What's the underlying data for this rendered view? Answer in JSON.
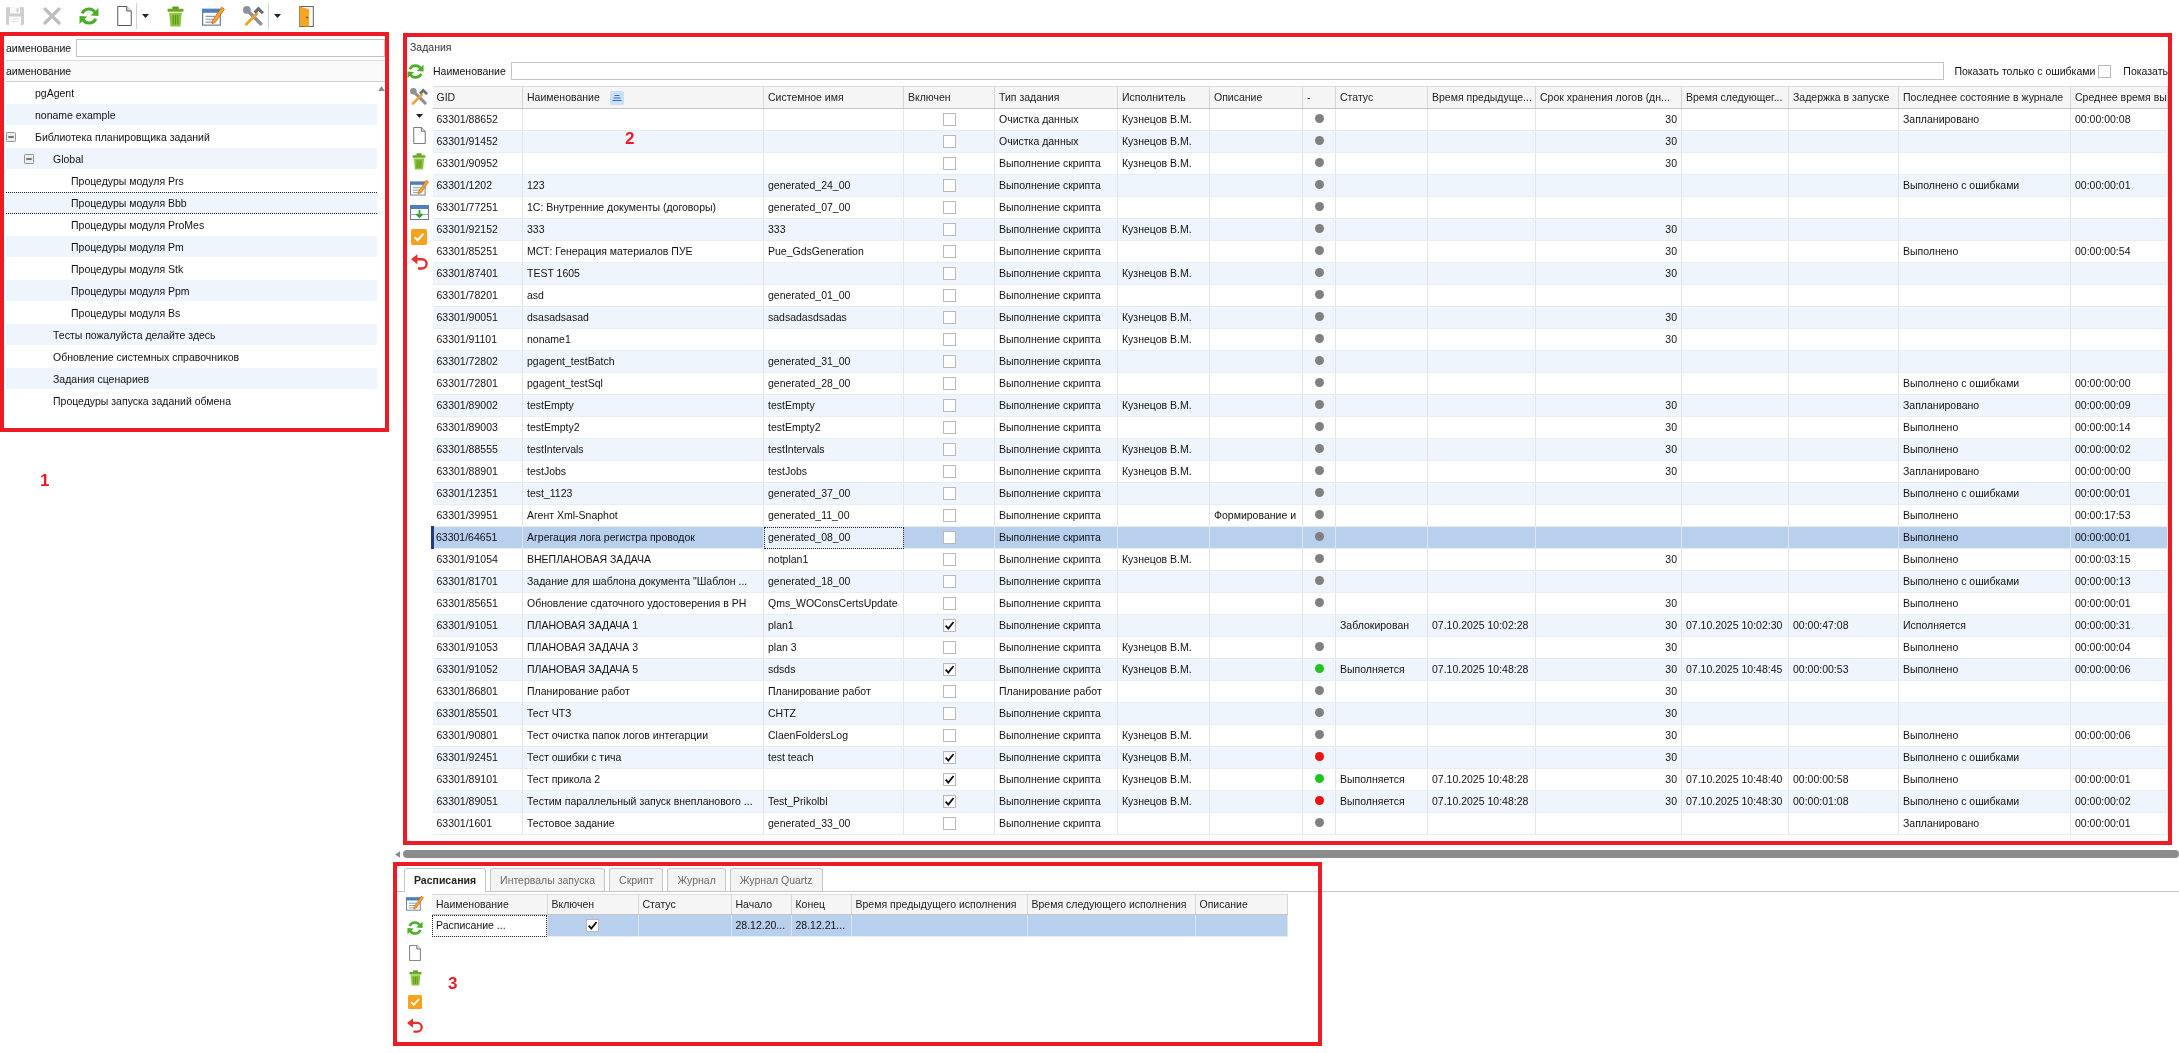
{
  "toolbar": [
    {
      "disabled": true
    },
    {
      "disabled": true
    },
    {
      "disabled": false
    },
    {
      "disabled": false,
      "dropdown": true
    },
    {
      "disabled": false
    },
    {
      "disabled": false
    },
    {
      "disabled": false,
      "dropdown": true
    },
    {
      "disabled": false
    }
  ],
  "tree_panel": {
    "annotation": "1",
    "filter": {
      "label": "аименование"
    },
    "header": "аименование",
    "items": [
      {
        "label": "pgAgent",
        "selected": false
      },
      {
        "label": "noname example",
        "selected": false
      },
      {
        "label": "Библиотека планировщика заданий",
        "selected": false,
        "expanded": true,
        "children": [
          {
            "label": "Global",
            "selected": false,
            "expanded": true,
            "children": [
              {
                "label": "Процедуры модуля Prs",
                "selected": false
              },
              {
                "label": "Процедуры модуля Bbb",
                "selected": true
              },
              {
                "label": "Процедуры модуля ProMes",
                "selected": false
              },
              {
                "label": "Процедуры модуля Pm",
                "selected": false
              },
              {
                "label": "Процедуры модуля Stk",
                "selected": false
              },
              {
                "label": "Процедуры модуля Ppm",
                "selected": false
              },
              {
                "label": "Процедуры модуля Bs",
                "selected": false
              }
            ]
          },
          {
            "label": "Тесты пожалуйста делайте здесь",
            "selected": false
          },
          {
            "label": "Обновление системных справочников",
            "selected": false
          },
          {
            "label": "Задания сценариев",
            "selected": false
          },
          {
            "label": "Процедуры запуска заданий обмена",
            "selected": false
          }
        ]
      }
    ]
  },
  "jobs_panel": {
    "annotation": "2",
    "title": "Задания",
    "filter": {
      "label": "Наименование"
    },
    "errors_only": {
      "label": "Показать только с ошибками",
      "checked": false
    },
    "show_label": "Показать",
    "table": {
      "columns": [
        {
          "label": "GID",
          "sorted": false
        },
        {
          "label": "Наименование",
          "sorted": true
        },
        {
          "label": "Системное имя",
          "sorted": false
        },
        {
          "label": "Включен",
          "sorted": false
        },
        {
          "label": "Тип задания",
          "sorted": false
        },
        {
          "label": "Исполнитель",
          "sorted": false
        },
        {
          "label": "Описание",
          "sorted": false
        },
        {
          "label": "-",
          "sorted": false
        },
        {
          "label": "Статус",
          "sorted": false
        },
        {
          "label": "Время предыдуще...",
          "sorted": false
        },
        {
          "label": "Срок хранения логов (дн...",
          "sorted": false
        },
        {
          "label": "Время следующег...",
          "sorted": false
        },
        {
          "label": "Задержка в запуске",
          "sorted": false
        },
        {
          "label": "Последнее состояние в журнале",
          "sorted": false
        },
        {
          "label": "Среднее время вы",
          "sorted": false
        }
      ],
      "rows": [
        {
          "gid": "63301/88652",
          "checked": false,
          "type": "Очистка данных",
          "executor": "Кузнецов В.М.",
          "color": "#808080",
          "log_days": "30",
          "last_state": "Запланировано",
          "avg_time": "00:00:00:08",
          "selected": false
        },
        {
          "gid": "63301/91452",
          "checked": false,
          "type": "Очистка данных",
          "executor": "Кузнецов В.М.",
          "color": "#808080",
          "log_days": "30",
          "selected": false
        },
        {
          "gid": "63301/90952",
          "checked": false,
          "type": "Выполнение скрипта",
          "executor": "Кузнецов В.М.",
          "color": "#808080",
          "log_days": "30",
          "selected": false
        },
        {
          "gid": "63301/1202",
          "name": "123",
          "system_name": "generated_24_00",
          "checked": false,
          "type": "Выполнение скрипта",
          "color": "#808080",
          "last_state": "Выполнено с ошибками",
          "avg_time": "00:00:00:01",
          "selected": false
        },
        {
          "gid": "63301/77251",
          "name": "1С: Внутренние документы (договоры)",
          "system_name": "generated_07_00",
          "checked": false,
          "type": "Выполнение скрипта",
          "color": "#808080",
          "selected": false
        },
        {
          "gid": "63301/92152",
          "name": "333",
          "system_name": "333",
          "checked": false,
          "type": "Выполнение скрипта",
          "executor": "Кузнецов В.М.",
          "color": "#808080",
          "log_days": "30",
          "selected": false
        },
        {
          "gid": "63301/85251",
          "name": "МСТ: Генерация материалов ПУЕ",
          "system_name": "Pue_GdsGeneration",
          "checked": false,
          "type": "Выполнение скрипта",
          "color": "#808080",
          "log_days": "30",
          "last_state": "Выполнено",
          "avg_time": "00:00:00:54",
          "selected": false
        },
        {
          "gid": "63301/87401",
          "name": "TEST 1605",
          "checked": false,
          "type": "Выполнение скрипта",
          "executor": "Кузнецов В.М.",
          "color": "#808080",
          "log_days": "30",
          "selected": false
        },
        {
          "gid": "63301/78201",
          "name": "asd",
          "system_name": "generated_01_00",
          "checked": false,
          "type": "Выполнение скрипта",
          "color": "#808080",
          "selected": false
        },
        {
          "gid": "63301/90051",
          "name": "dsasadsasad",
          "system_name": "sadsadasdsadas",
          "checked": false,
          "type": "Выполнение скрипта",
          "executor": "Кузнецов В.М.",
          "color": "#808080",
          "log_days": "30",
          "selected": false
        },
        {
          "gid": "63301/91101",
          "name": "noname1",
          "checked": false,
          "type": "Выполнение скрипта",
          "executor": "Кузнецов В.М.",
          "color": "#808080",
          "log_days": "30",
          "selected": false
        },
        {
          "gid": "63301/72802",
          "name": "pgagent_testBatch",
          "system_name": "generated_31_00",
          "checked": false,
          "type": "Выполнение скрипта",
          "color": "#808080",
          "selected": false
        },
        {
          "gid": "63301/72801",
          "name": "pgagent_testSql",
          "system_name": "generated_28_00",
          "checked": false,
          "type": "Выполнение скрипта",
          "color": "#808080",
          "last_state": "Выполнено с ошибками",
          "avg_time": "00:00:00:00",
          "selected": false
        },
        {
          "gid": "63301/89002",
          "name": "testEmpty",
          "system_name": "testEmpty",
          "checked": false,
          "type": "Выполнение скрипта",
          "executor": "Кузнецов В.М.",
          "color": "#808080",
          "log_days": "30",
          "last_state": "Запланировано",
          "avg_time": "00:00:00:09",
          "selected": false
        },
        {
          "gid": "63301/89003",
          "name": "testEmpty2",
          "system_name": "testEmpty2",
          "checked": false,
          "type": "Выполнение скрипта",
          "color": "#808080",
          "log_days": "30",
          "last_state": "Выполнено",
          "avg_time": "00:00:00:14",
          "selected": false
        },
        {
          "gid": "63301/88555",
          "name": "testIntervals",
          "system_name": "testIntervals",
          "checked": false,
          "type": "Выполнение скрипта",
          "executor": "Кузнецов В.М.",
          "color": "#808080",
          "log_days": "30",
          "last_state": "Выполнено",
          "avg_time": "00:00:00:02",
          "selected": false
        },
        {
          "gid": "63301/88901",
          "name": "testJobs",
          "system_name": "testJobs",
          "checked": false,
          "type": "Выполнение скрипта",
          "executor": "Кузнецов В.М.",
          "color": "#808080",
          "log_days": "30",
          "last_state": "Запланировано",
          "avg_time": "00:00:00:00",
          "selected": false
        },
        {
          "gid": "63301/12351",
          "name": "test_1123",
          "system_name": "generated_37_00",
          "checked": false,
          "type": "Выполнение скрипта",
          "color": "#808080",
          "last_state": "Выполнено с ошибками",
          "avg_time": "00:00:00:01",
          "selected": false
        },
        {
          "gid": "63301/39951",
          "name": "Агент Xml-Snaphot",
          "system_name": "generated_11_00",
          "checked": false,
          "type": "Выполнение скрипта",
          "description": "Формирование и",
          "color": "#808080",
          "last_state": "Выполнено",
          "avg_time": "00:00:17:53",
          "selected": false
        },
        {
          "gid": "63301/64651",
          "name": "Агрегация лога регистра проводок",
          "system_name": "generated_08_00",
          "checked": false,
          "type": "Выполнение скрипта",
          "color": "#808080",
          "last_state": "Выполнено",
          "avg_time": "00:00:00:01",
          "selected": true
        },
        {
          "gid": "63301/91054",
          "name": "ВНЕПЛАНОВАЯ ЗАДАЧА",
          "system_name": "notplan1",
          "checked": false,
          "type": "Выполнение скрипта",
          "executor": "Кузнецов В.М.",
          "color": "#808080",
          "log_days": "30",
          "last_state": "Выполнено",
          "avg_time": "00:00:03:15",
          "selected": false
        },
        {
          "gid": "63301/81701",
          "name": "Задание для шаблона документа \"Шаблон ...",
          "system_name": "generated_18_00",
          "checked": false,
          "type": "Выполнение скрипта",
          "color": "#808080",
          "last_state": "Выполнено с ошибками",
          "avg_time": "00:00:00:13",
          "selected": false
        },
        {
          "gid": "63301/85651",
          "name": "Обновление сдаточного удостоверения в РН",
          "system_name": "Qms_WOConsCertsUpdate",
          "checked": false,
          "type": "Выполнение скрипта",
          "color": "#808080",
          "log_days": "30",
          "last_state": "Выполнено",
          "avg_time": "00:00:00:01",
          "selected": false
        },
        {
          "gid": "63301/91051",
          "name": "ПЛАНОВАЯ ЗАДАЧА 1",
          "system_name": "plan1",
          "checked": true,
          "type": "Выполнение скрипта",
          "status": "Заблокирован",
          "prev_run": "07.10.2025 10:02:28",
          "log_days": "30",
          "next_run": "07.10.2025 10:02:30",
          "delay": "00:00:47:08",
          "last_state": "Исполняется",
          "avg_time": "00:00:00:31",
          "selected": false
        },
        {
          "gid": "63301/91053",
          "name": "ПЛАНОВАЯ ЗАДАЧА 3",
          "system_name": "plan 3",
          "checked": false,
          "type": "Выполнение скрипта",
          "executor": "Кузнецов В.М.",
          "color": "#808080",
          "log_days": "30",
          "last_state": "Выполнено",
          "avg_time": "00:00:00:04",
          "selected": false
        },
        {
          "gid": "63301/91052",
          "name": "ПЛАНОВАЯ ЗАДАЧА 5",
          "system_name": "sdsds",
          "checked": true,
          "type": "Выполнение скрипта",
          "executor": "Кузнецов В.М.",
          "color": "#22c322",
          "status": "Выполняется",
          "prev_run": "07.10.2025 10:48:28",
          "log_days": "30",
          "next_run": "07.10.2025 10:48:45",
          "delay": "00:00:00:53",
          "last_state": "Выполнено",
          "avg_time": "00:00:00:06",
          "selected": false
        },
        {
          "gid": "63301/86801",
          "name": "Планирование работ",
          "system_name": "Планирование работ",
          "checked": false,
          "type": "Планирование работ",
          "color": "#808080",
          "log_days": "30",
          "selected": false
        },
        {
          "gid": "63301/85501",
          "name": "Тест ЧТЗ",
          "system_name": "CHTZ",
          "checked": false,
          "type": "Выполнение скрипта",
          "color": "#808080",
          "log_days": "30",
          "selected": false
        },
        {
          "gid": "63301/90801",
          "name": "Тест очистка папок логов интегарции",
          "system_name": "ClaenFoldersLog",
          "checked": false,
          "type": "Выполнение скрипта",
          "executor": "Кузнецов В.М.",
          "color": "#808080",
          "log_days": "30",
          "last_state": "Выполнено",
          "avg_time": "00:00:00:06",
          "selected": false
        },
        {
          "gid": "63301/92451",
          "name": "Тест ошибки с тича",
          "system_name": "test teach",
          "checked": true,
          "type": "Выполнение скрипта",
          "executor": "Кузнецов В.М.",
          "color": "#ee1111",
          "log_days": "30",
          "last_state": "Выполнено с ошибками",
          "selected": false
        },
        {
          "gid": "63301/89101",
          "name": "Тест прикола 2",
          "checked": true,
          "type": "Выполнение скрипта",
          "executor": "Кузнецов В.М.",
          "color": "#22c322",
          "status": "Выполняется",
          "prev_run": "07.10.2025 10:48:28",
          "log_days": "30",
          "next_run": "07.10.2025 10:48:40",
          "delay": "00:00:00:58",
          "last_state": "Выполнено",
          "avg_time": "00:00:00:01",
          "selected": false
        },
        {
          "gid": "63301/89051",
          "name": "Тестим параллельный запуск внепланового ...",
          "system_name": "Test_Prikolbl",
          "checked": true,
          "type": "Выполнение скрипта",
          "executor": "Кузнецов В.М.",
          "color": "#ee1111",
          "status": "Выполняется",
          "prev_run": "07.10.2025 10:48:28",
          "log_days": "30",
          "next_run": "07.10.2025 10:48:30",
          "delay": "00:00:01:08",
          "last_state": "Выполнено с ошибками",
          "avg_time": "00:00:00:02",
          "selected": false
        },
        {
          "gid": "63301/1601",
          "name": "Тестовое задание",
          "system_name": "generated_33_00",
          "checked": false,
          "type": "Выполнение скрипта",
          "color": "#808080",
          "last_state": "Запланировано",
          "avg_time": "00:00:00:01",
          "selected": false
        }
      ]
    }
  },
  "details_panel": {
    "annotation": "3",
    "tabs": [
      {
        "label": "Расписания",
        "selected": true
      },
      {
        "label": "Интервалы запуска",
        "selected": false
      },
      {
        "label": "Скрипт",
        "selected": false
      },
      {
        "label": "Журнал",
        "selected": false
      },
      {
        "label": "Журнал Quartz",
        "selected": false
      }
    ],
    "table": {
      "columns": [
        "Наименование",
        "Включен",
        "Статус",
        "Начало",
        "Конец",
        "Время предыдущего исполнения",
        "Время следующего исполнения",
        "Описание"
      ],
      "rows": [
        {
          "name": "Расписание ...",
          "checked": true,
          "start": "28.12.20...",
          "end": "28.12.21...",
          "selected": true
        }
      ]
    }
  }
}
